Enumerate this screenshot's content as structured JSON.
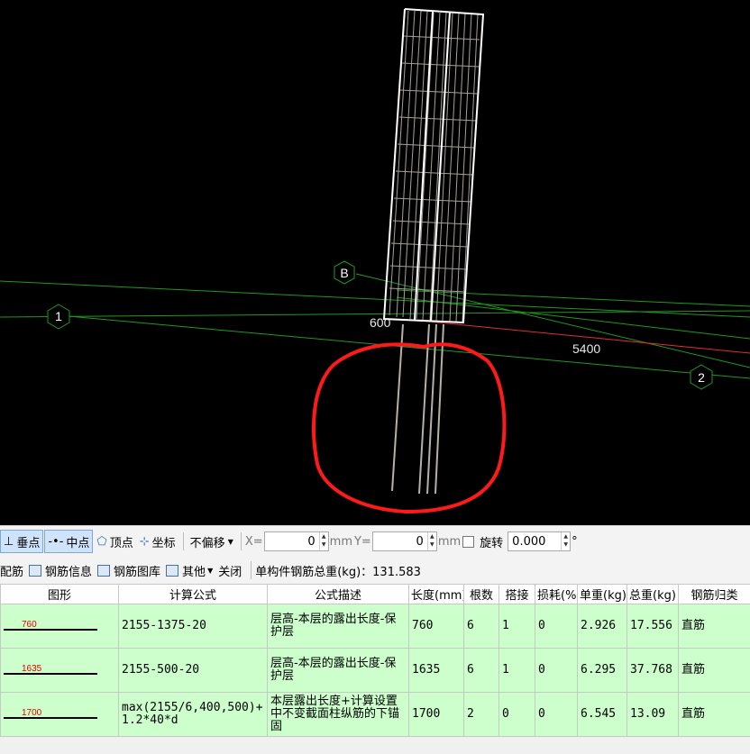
{
  "viewport": {
    "axis_labels": [
      "B",
      "1",
      "2"
    ],
    "dimension_labels": [
      "600",
      "5400"
    ]
  },
  "snapbar": {
    "perpendicular": "垂点",
    "midpoint": "中点",
    "vertex": "顶点",
    "coordinate": "坐标",
    "offset_mode": "不偏移",
    "x_label": "X=",
    "x_value": "0",
    "x_unit": "mm",
    "y_label": "Y=",
    "y_value": "0",
    "y_unit": "mm",
    "rotate_label": "旋转",
    "rotate_value": "0.000",
    "degree": "°"
  },
  "toolbar": {
    "scale_rebar": "缩尺配筋",
    "rebar_info": "钢筋信息",
    "rebar_library": "钢筋图库",
    "other": "其他",
    "close": "关闭",
    "total_weight": "单构件钢筋总重(kg)：131.583"
  },
  "table": {
    "headers": [
      "图形",
      "计算公式",
      "公式描述",
      "长度(mm)",
      "根数",
      "搭接",
      "损耗(%)",
      "单重(kg)",
      "总重(kg)",
      "钢筋归类"
    ],
    "rows": [
      {
        "shape_length": "760",
        "formula": "2155-1375-20",
        "desc": "层高-本层的露出长度-保护层",
        "length": "760",
        "count": "6",
        "lap": "1",
        "loss": "0",
        "unit_weight": "2.926",
        "total_weight": "17.556",
        "category": "直筋"
      },
      {
        "shape_length": "1635",
        "formula": "2155-500-20",
        "desc": "层高-本层的露出长度-保护层",
        "length": "1635",
        "count": "6",
        "lap": "1",
        "loss": "0",
        "unit_weight": "6.295",
        "total_weight": "37.768",
        "category": "直筋"
      },
      {
        "shape_length": "1700",
        "formula": "max(2155/6,400,500)+1.2*40*d",
        "desc": "本层露出长度+计算设置中不变截面柱纵筋的下锚固",
        "length": "1700",
        "count": "2",
        "lap": "0",
        "loss": "0",
        "unit_weight": "6.545",
        "total_weight": "13.09",
        "category": "直筋"
      }
    ]
  }
}
